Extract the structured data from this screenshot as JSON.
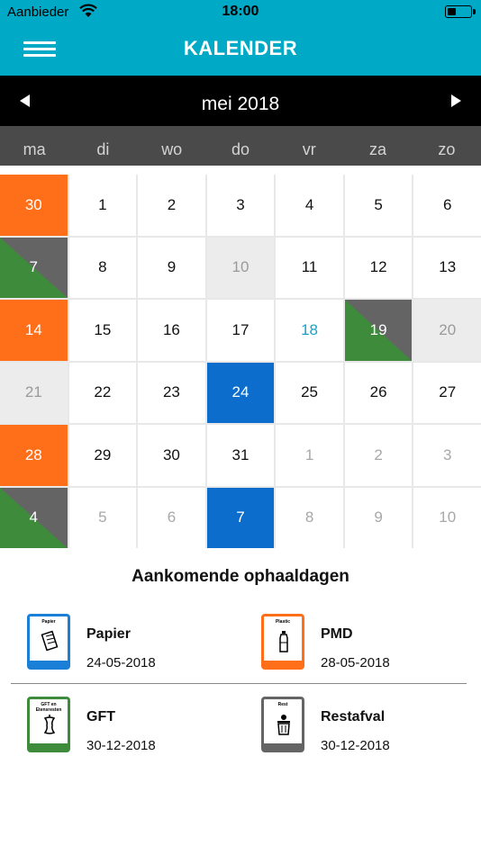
{
  "status": {
    "carrier": "Aanbieder",
    "time": "18:00"
  },
  "header": {
    "title": "KALENDER"
  },
  "calendar": {
    "month_label": "mei 2018",
    "weekdays": [
      "ma",
      "di",
      "wo",
      "do",
      "vr",
      "za",
      "zo"
    ],
    "days": [
      {
        "d": "30",
        "style": "orange"
      },
      {
        "d": "1",
        "style": ""
      },
      {
        "d": "2",
        "style": ""
      },
      {
        "d": "3",
        "style": ""
      },
      {
        "d": "4",
        "style": ""
      },
      {
        "d": "5",
        "style": ""
      },
      {
        "d": "6",
        "style": ""
      },
      {
        "d": "7",
        "style": "split"
      },
      {
        "d": "8",
        "style": ""
      },
      {
        "d": "9",
        "style": ""
      },
      {
        "d": "10",
        "style": "grey"
      },
      {
        "d": "11",
        "style": ""
      },
      {
        "d": "12",
        "style": ""
      },
      {
        "d": "13",
        "style": ""
      },
      {
        "d": "14",
        "style": "orange"
      },
      {
        "d": "15",
        "style": ""
      },
      {
        "d": "16",
        "style": ""
      },
      {
        "d": "17",
        "style": ""
      },
      {
        "d": "18",
        "style": "today"
      },
      {
        "d": "19",
        "style": "split"
      },
      {
        "d": "20",
        "style": "grey"
      },
      {
        "d": "21",
        "style": "grey"
      },
      {
        "d": "22",
        "style": ""
      },
      {
        "d": "23",
        "style": ""
      },
      {
        "d": "24",
        "style": "blue"
      },
      {
        "d": "25",
        "style": ""
      },
      {
        "d": "26",
        "style": ""
      },
      {
        "d": "27",
        "style": ""
      },
      {
        "d": "28",
        "style": "orange"
      },
      {
        "d": "29",
        "style": ""
      },
      {
        "d": "30",
        "style": ""
      },
      {
        "d": "31",
        "style": ""
      },
      {
        "d": "1",
        "style": "other"
      },
      {
        "d": "2",
        "style": "other"
      },
      {
        "d": "3",
        "style": "other"
      },
      {
        "d": "4",
        "style": "split"
      },
      {
        "d": "5",
        "style": "other"
      },
      {
        "d": "6",
        "style": "other"
      },
      {
        "d": "7",
        "style": "blue"
      },
      {
        "d": "8",
        "style": "other"
      },
      {
        "d": "9",
        "style": "other"
      },
      {
        "d": "10",
        "style": "other"
      }
    ]
  },
  "upcoming": {
    "title": "Aankomende ophaaldagen",
    "items": [
      {
        "name": "Papier",
        "date": "24-05-2018",
        "bin_label": "Papier",
        "color": "#1a7fd6",
        "icon": "paper-icon"
      },
      {
        "name": "PMD",
        "date": "28-05-2018",
        "bin_label": "Plastic",
        "color": "#ff6f1a",
        "icon": "bottle-icon"
      },
      {
        "name": "GFT",
        "date": "30-12-2018",
        "bin_label": "GFT en Etensresten",
        "color": "#3e8b3c",
        "icon": "apple-core-icon"
      },
      {
        "name": "Restafval",
        "date": "30-12-2018",
        "bin_label": "Rest",
        "color": "#646464",
        "icon": "trash-bin-icon"
      }
    ]
  },
  "colors": {
    "header": "#00a9c5",
    "papier": "#0d6dcc",
    "pmd": "#ff6f1a",
    "gft": "#3e8b3c",
    "rest": "#646464",
    "today": "#1aa0c6"
  }
}
